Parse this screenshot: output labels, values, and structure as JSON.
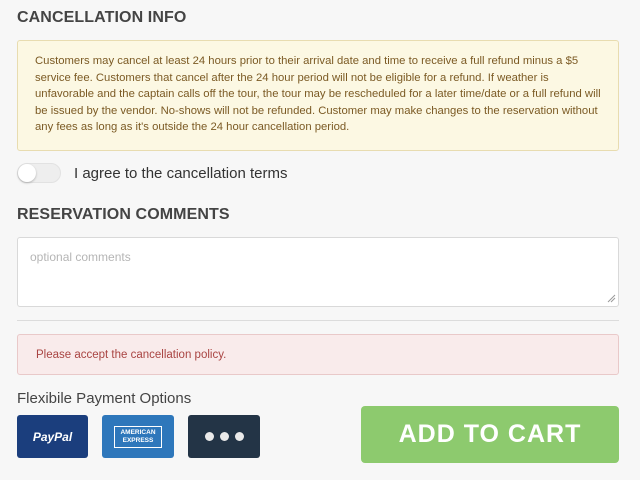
{
  "cancellation": {
    "title": "CANCELLATION INFO",
    "policy_text": "Customers may cancel at least 24 hours prior to their arrival date and time to receive a full refund minus a $5 service fee. Customers that cancel after the 24 hour period will not be eligible for a refund. If weather is unfavorable and the captain calls off the tour, the tour may be rescheduled for a later time/date or a full refund will be issued by the vendor. No-shows will not be refunded. Customer may make changes to the reservation without any fees as long as it's outside the 24 hour cancellation period.",
    "agree_label": "I agree to the cancellation terms",
    "agree_checked": false
  },
  "comments": {
    "title": "RESERVATION COMMENTS",
    "placeholder": "optional comments",
    "value": ""
  },
  "alert": {
    "message": "Please accept the cancellation policy.",
    "color": "#a94442"
  },
  "payment": {
    "title": "Flexibile Payment Options",
    "options": [
      {
        "name": "PayPal",
        "icon": "paypal-icon",
        "color": "#1b3e7d"
      },
      {
        "name": "AMERICAN EXPRESS",
        "icon": "amex-icon",
        "color": "#2e77bb"
      },
      {
        "name": "more",
        "icon": "more-dots-icon",
        "color": "#233446"
      }
    ]
  },
  "cart": {
    "button_label": "ADD TO CART",
    "color": "#8dca6e"
  }
}
